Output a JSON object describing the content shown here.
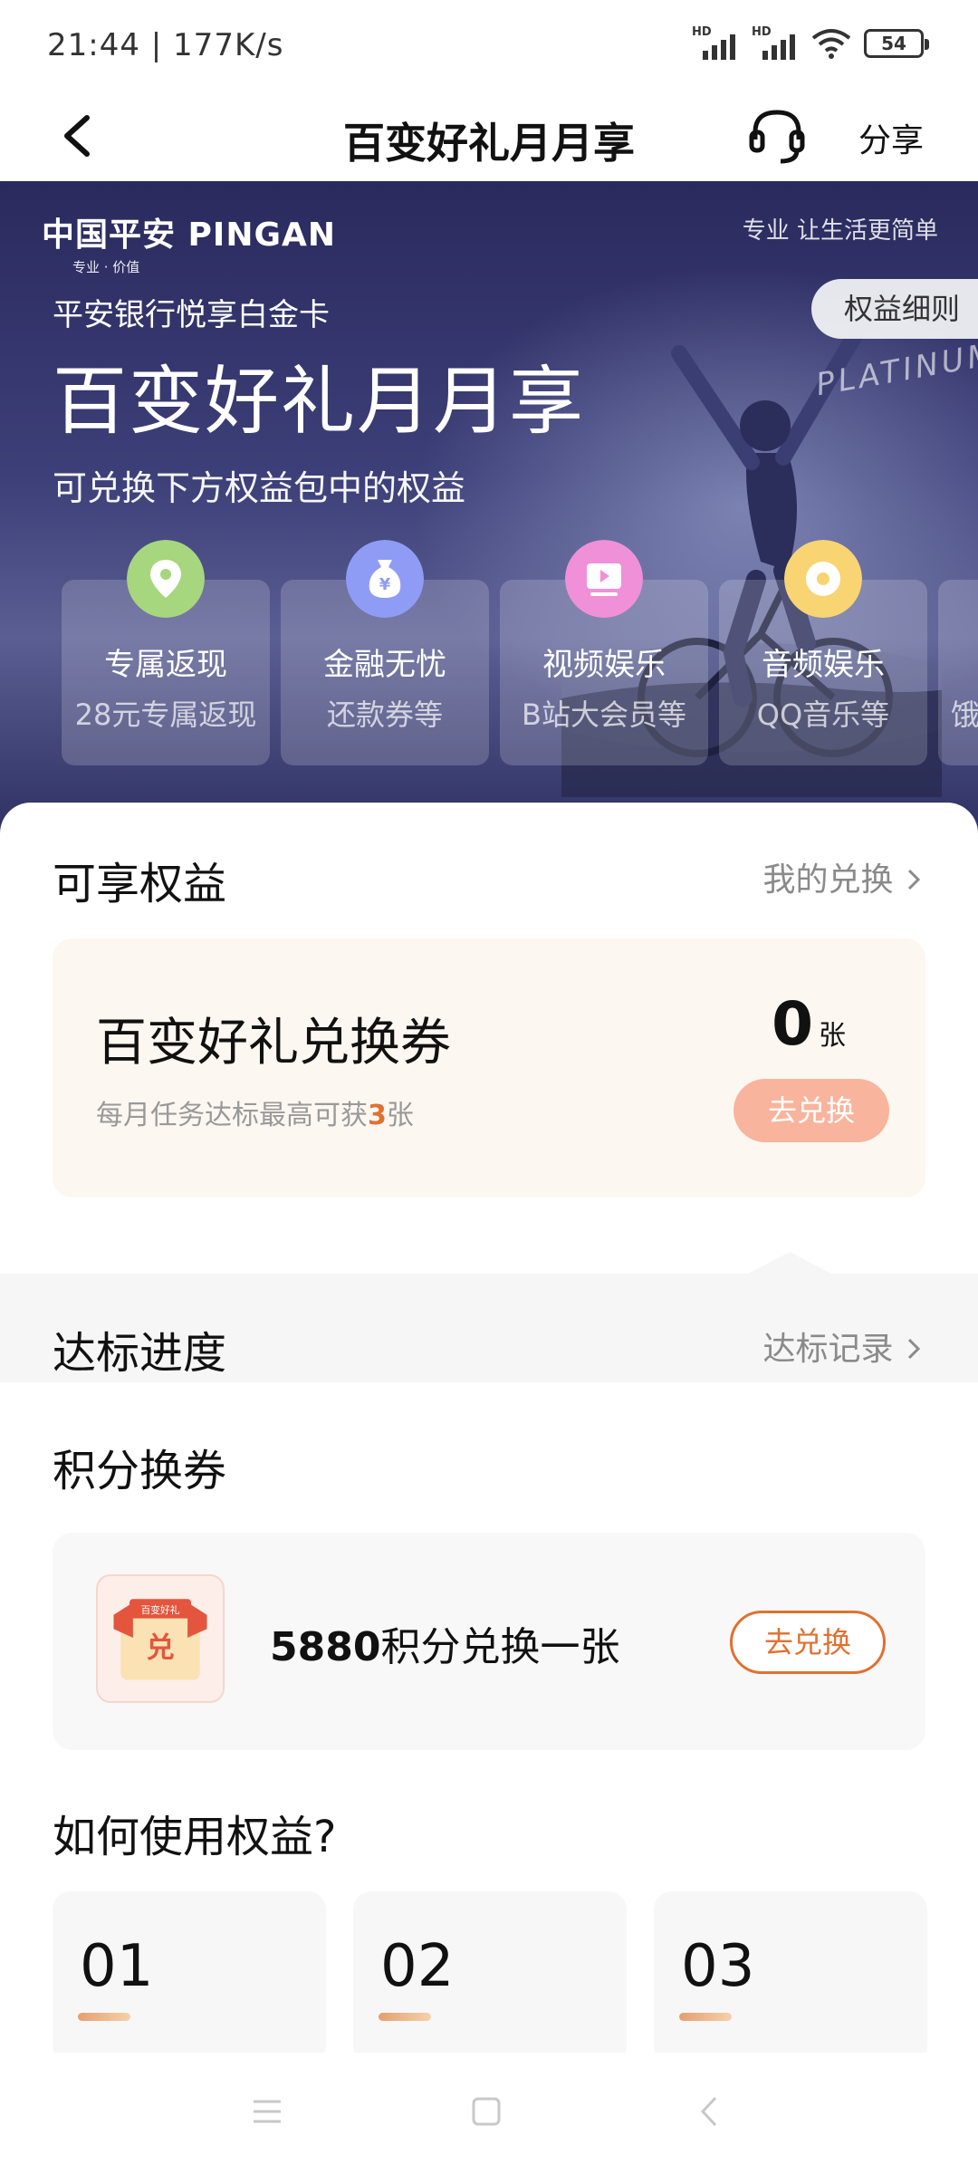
{
  "status_bar": {
    "time_speed": "21:44 | 177K/s",
    "signal_label_1": "HD",
    "signal_label_2": "HD",
    "battery": "54"
  },
  "nav": {
    "title": "百变好礼月月享",
    "share": "分享",
    "icons": [
      "back-arrow-icon",
      "headset-icon"
    ]
  },
  "hero": {
    "brand": "中国平安 PINGAN",
    "brand_sub": "专业 · 价值",
    "slogan": "专业 让生活更简单",
    "rules_button": "权益细则",
    "card_name": "平安银行悦享白金卡",
    "title": "百变好礼月月享",
    "description": "可兑换下方权益包中的权益",
    "platinum_text": "PLATINUM",
    "benefits": [
      {
        "name": "专属返现",
        "sub": "28元专属返现",
        "icon": "location-pin-icon",
        "color": "#a6d67e"
      },
      {
        "name": "金融无忧",
        "sub": "还款券等",
        "icon": "money-bag-icon",
        "color": "#8f9cf5"
      },
      {
        "name": "视频娱乐",
        "sub": "B站大会员等",
        "icon": "video-play-icon",
        "color": "#f090d8"
      },
      {
        "name": "音频娱乐",
        "sub": "QQ音乐等",
        "icon": "music-disc-icon",
        "color": "#f8d472"
      },
      {
        "name": "",
        "sub": "饿",
        "icon": "",
        "color": ""
      }
    ]
  },
  "benefits_section": {
    "title": "可享权益",
    "link": "我的兑换"
  },
  "voucher": {
    "title": "百变好礼兑换券",
    "note_prefix": "每月任务达标最高可获",
    "note_highlight": "3",
    "note_suffix": "张",
    "count": "0",
    "count_unit": "张",
    "button": "去兑换"
  },
  "progress_section": {
    "title": "达标进度",
    "link": "达标记录"
  },
  "points_section": {
    "title": "积分换券",
    "points_value": "5880",
    "points_text": "积分兑换一张",
    "icon_tag": "百变好礼",
    "icon_char": "兑",
    "button": "去兑换"
  },
  "howto_section": {
    "title": "如何使用权益?",
    "steps": [
      "01",
      "02",
      "03"
    ]
  },
  "colors": {
    "accent": "#e0712f",
    "button_disabled": "#f9b49d",
    "hero_bg": "#2f3163",
    "card_bg": "#fdf7f1"
  }
}
